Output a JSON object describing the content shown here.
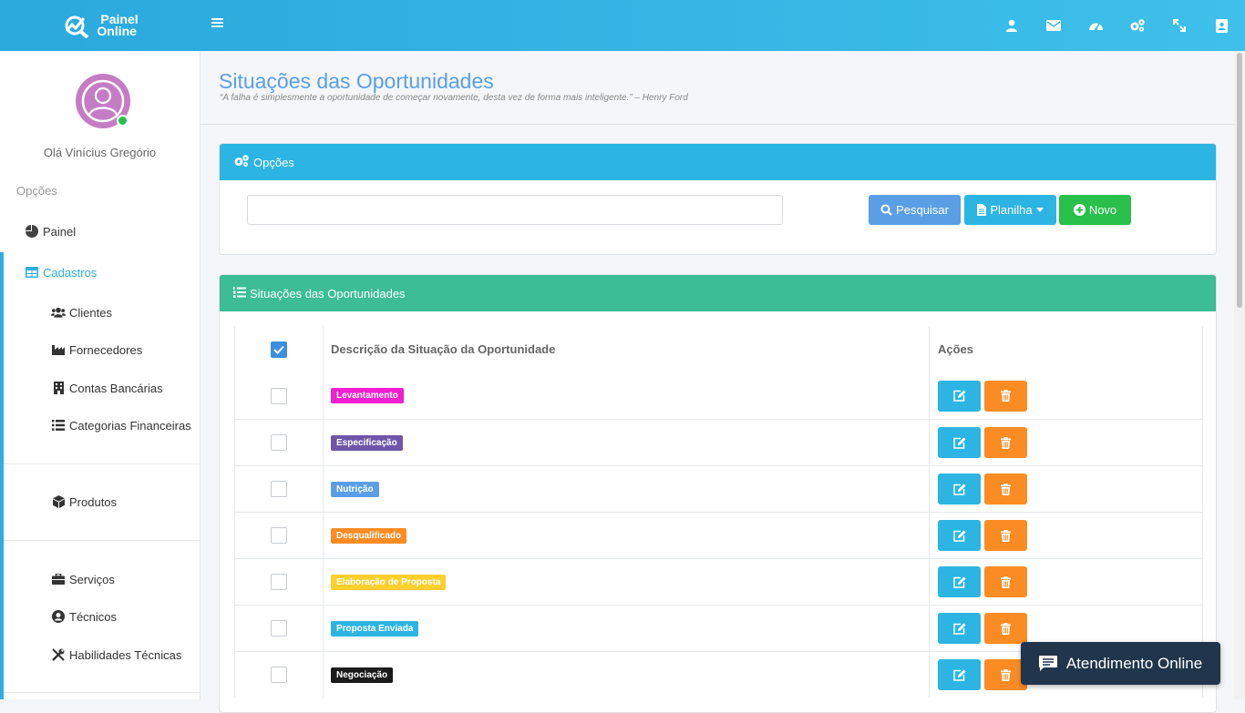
{
  "brand": {
    "line1": "Painel",
    "line2": "Online"
  },
  "topbar": {
    "icons": [
      "user-icon",
      "envelope-icon",
      "dashboard-icon",
      "cogs-icon",
      "expand-icon",
      "address-book-icon"
    ]
  },
  "sidebar": {
    "greeting": "Olá Vinícius Gregório",
    "section_label": "Opções",
    "items": [
      {
        "label": "Painel",
        "icon": "pie-chart-icon"
      },
      {
        "label": "Cadastros",
        "icon": "table-icon"
      },
      {
        "label": "Clientes",
        "icon": "users-icon"
      },
      {
        "label": "Fornecedores",
        "icon": "industry-icon"
      },
      {
        "label": "Contas Bancárias",
        "icon": "building-icon"
      },
      {
        "label": "Categorias Financeiras",
        "icon": "list-icon"
      },
      {
        "label": "Produtos",
        "icon": "cube-icon"
      },
      {
        "label": "Serviços",
        "icon": "briefcase-icon"
      },
      {
        "label": "Técnicos",
        "icon": "user-circle-icon"
      },
      {
        "label": "Habilidades Técnicas",
        "icon": "tools-icon"
      }
    ]
  },
  "header": {
    "title": "Situações das Oportunidades",
    "quote": "“A falha é simplesmente a oportunidade de começar novamente, desta vez de forma mais inteligente.” – Henry Ford"
  },
  "options_panel": {
    "title": "Opções",
    "search_value": "",
    "search_label": "Pesquisar",
    "sheet_label": "Planilha",
    "new_label": "Novo"
  },
  "list_panel": {
    "title": "Situações das Oportunidades",
    "col_description": "Descrição da Situação da Oportunidade",
    "col_actions": "Ações",
    "rows": [
      {
        "label": "Levantamento",
        "color": "#f01fd2",
        "text_color": "#ffffff"
      },
      {
        "label": "Especificação",
        "color": "#6f56a8",
        "text_color": "#ffffff"
      },
      {
        "label": "Nutrição",
        "color": "#5a9ee6",
        "text_color": "#ffffff"
      },
      {
        "label": "Desqualificado",
        "color": "#fb8c24",
        "text_color": "#ffffff"
      },
      {
        "label": "Elaboração de Proposta",
        "color": "#fccf2c",
        "text_color": "#ffffff"
      },
      {
        "label": "Proposta Enviada",
        "color": "#2cb5e2",
        "text_color": "#ffffff"
      },
      {
        "label": "Negociação",
        "color": "#1b1b1b",
        "text_color": "#ffffff"
      }
    ]
  },
  "chat": {
    "label": "Atendimento Online"
  }
}
